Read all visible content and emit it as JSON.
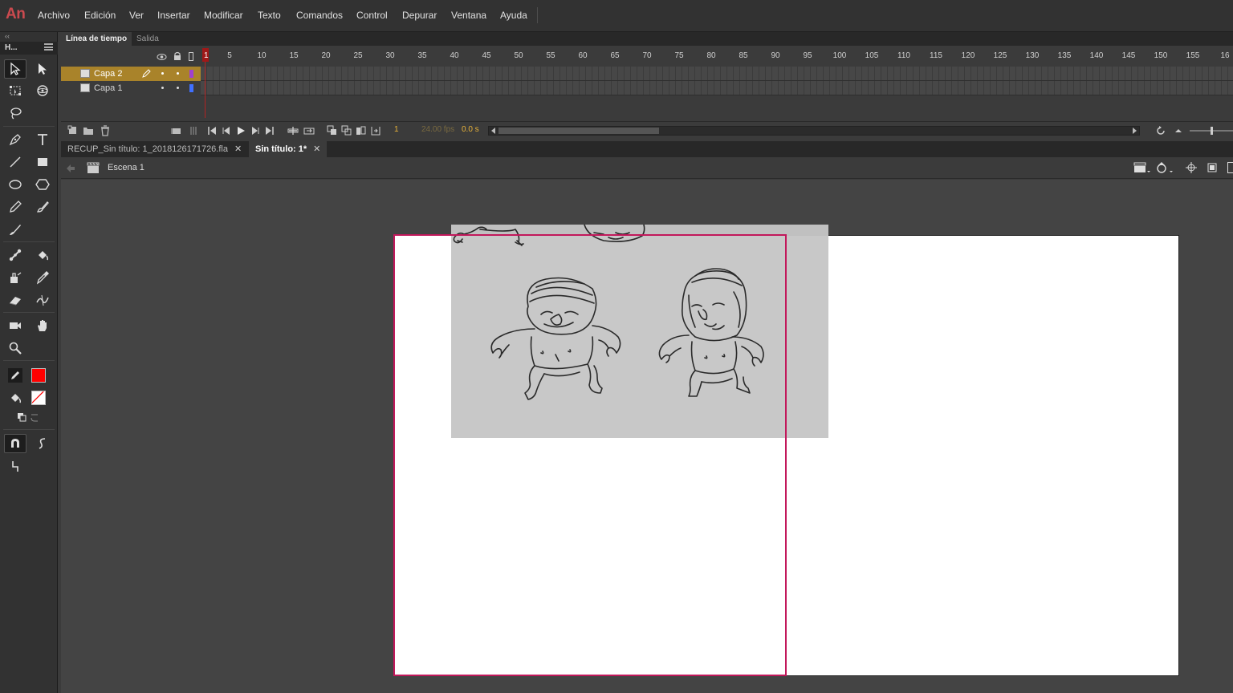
{
  "app": {
    "logo": "An",
    "menu": [
      "Archivo",
      "Edición",
      "Ver",
      "Insertar",
      "Modificar",
      "Texto",
      "Comandos",
      "Control",
      "Depurar",
      "Ventana",
      "Ayuda"
    ]
  },
  "toolbar": {
    "title": "H...",
    "collapse": "‹‹",
    "stroke_color": "#ff0000",
    "fill_color": "none"
  },
  "timeline": {
    "tabs": [
      "Línea de tiempo",
      "Salida"
    ],
    "ruler_labels": [
      "1",
      "5",
      "10",
      "15",
      "20",
      "25",
      "30",
      "35",
      "40",
      "45",
      "50",
      "55",
      "60",
      "65",
      "70",
      "75",
      "80",
      "85",
      "90",
      "95",
      "100",
      "105",
      "110",
      "115",
      "120",
      "125",
      "130",
      "135",
      "140",
      "145",
      "150",
      "155",
      "16"
    ],
    "layers": [
      {
        "name": "Capa 2",
        "selected": true,
        "color": "#a040d0"
      },
      {
        "name": "Capa 1",
        "selected": false,
        "color": "#4070ff"
      }
    ],
    "current_frame": "1",
    "fps": "24.00 fps",
    "time": "0.0 s"
  },
  "documents": {
    "tabs": [
      {
        "label": "RECUP_Sin título: 1_2018126171726.fla",
        "active": false
      },
      {
        "label": "Sin título: 1*",
        "active": true
      }
    ],
    "close_glyph": "✕"
  },
  "editbar": {
    "scene": "Escena 1"
  }
}
